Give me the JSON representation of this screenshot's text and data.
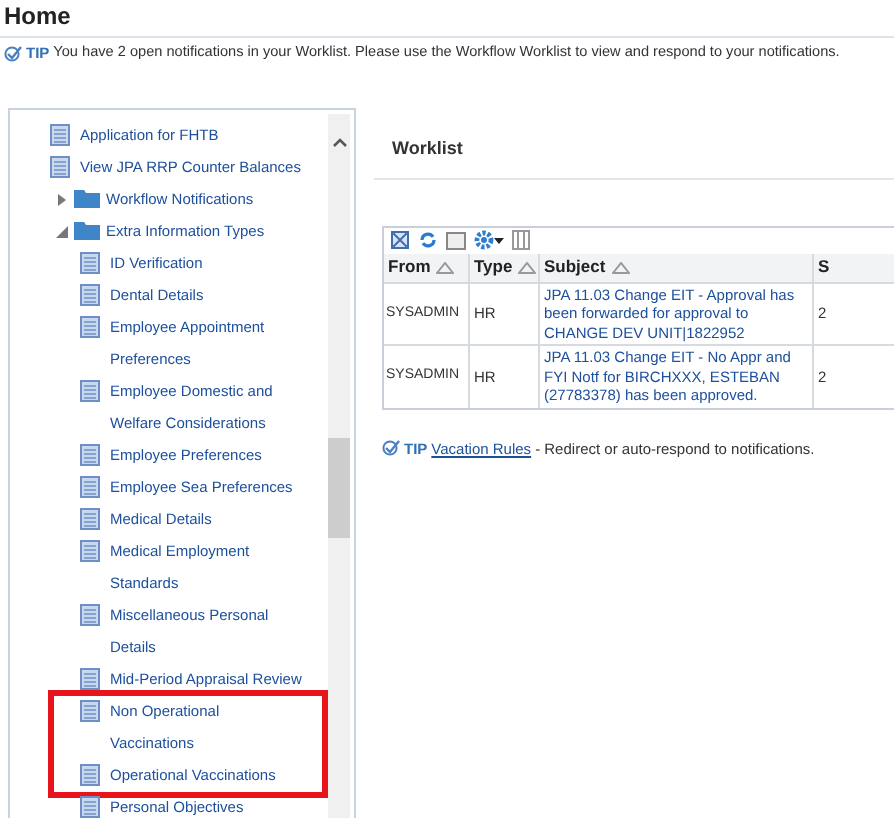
{
  "page_title": "Home",
  "tip": {
    "label": "TIP",
    "text": "You have 2 open notifications in your Worklist. Please use the Workflow Worklist to view and respond to your notifications."
  },
  "tree": [
    {
      "kind": "page",
      "label": "Application for FHTB"
    },
    {
      "kind": "page",
      "label": "View JPA RRP Counter Balances"
    },
    {
      "kind": "folder",
      "label": "Workflow Notifications",
      "expanded": false
    },
    {
      "kind": "folder",
      "label": "Extra Information Types",
      "expanded": true,
      "children": [
        {
          "kind": "page",
          "label": "ID Verification",
          "highlighted": false
        },
        {
          "kind": "page",
          "label": "Dental Details",
          "highlighted": false
        },
        {
          "kind": "page",
          "label": "Employee Appointment Preferences",
          "highlighted": false
        },
        {
          "kind": "page",
          "label": "Employee Domestic and Welfare Considerations",
          "highlighted": false
        },
        {
          "kind": "page",
          "label": "Employee Preferences",
          "highlighted": false
        },
        {
          "kind": "page",
          "label": "Employee Sea Preferences",
          "highlighted": false
        },
        {
          "kind": "page",
          "label": "Medical Details",
          "highlighted": false
        },
        {
          "kind": "page",
          "label": "Medical Employment Standards",
          "highlighted": false
        },
        {
          "kind": "page",
          "label": "Miscellaneous Personal Details",
          "highlighted": false
        },
        {
          "kind": "page",
          "label": "Mid-Period Appraisal Review",
          "highlighted": false
        },
        {
          "kind": "page",
          "label": "Non Operational Vaccinations",
          "highlighted": true
        },
        {
          "kind": "page",
          "label": "Operational Vaccinations",
          "highlighted": true
        },
        {
          "kind": "page",
          "label": "Personal Objectives",
          "highlighted": false
        }
      ]
    }
  ],
  "worklist": {
    "title": "Worklist",
    "columns": [
      {
        "label": "From",
        "sortable": true
      },
      {
        "label": "Type",
        "sortable": true
      },
      {
        "label": "Subject",
        "sortable": true
      },
      {
        "label": "S",
        "sortable": false
      }
    ],
    "rows": [
      {
        "from": "SYSADMIN",
        "type": "HR",
        "subject": "JPA 11.03 Change EIT - Approval has been forwarded for approval to CHANGE DEV UNIT|1822952",
        "column_4": "2"
      },
      {
        "from": "SYSADMIN",
        "type": "HR",
        "subject": "JPA 11.03 Change EIT - No Appr and FYI Notf for BIRCHXXX, ESTEBAN (27783378) has been approved.",
        "column_4": "2"
      }
    ],
    "tip": {
      "label": "TIP",
      "link": "Vacation Rules",
      "text": "- Redirect or auto-respond to notifications."
    }
  }
}
